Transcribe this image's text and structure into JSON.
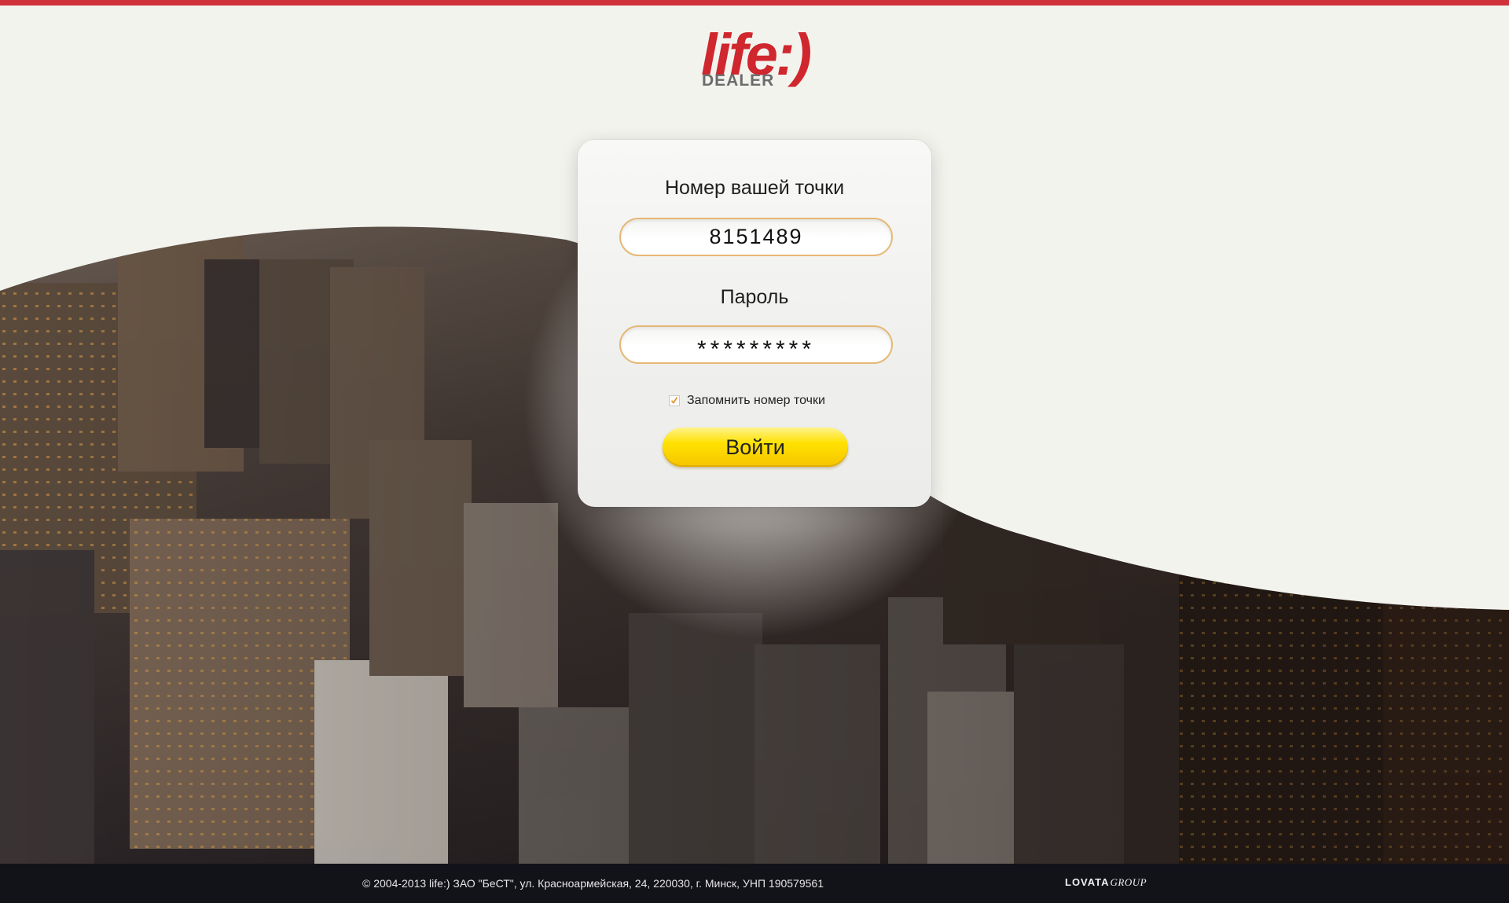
{
  "brand": {
    "logo_text": "life:)",
    "logo_sub": "DEALER",
    "accent_color": "#d0262e",
    "top_bar_color": "#d0303a"
  },
  "login_form": {
    "point_label": "Номер вашей точки",
    "point_value": "8151489",
    "password_label": "Пароль",
    "password_mask": "*********",
    "remember_label": "Запомнить номер точки",
    "remember_checked": true,
    "submit_label": "Войти",
    "input_border_color": "#e6b875",
    "button_color": "#ffe100"
  },
  "background": {
    "image": "city-skyline-aerial"
  },
  "footer": {
    "copyright": "© 2004-2013 life:) ЗАО \"БеСТ\", ул. Красноармейская, 24, 220030, г. Минск, УНП 190579561",
    "partner_a": "LOVATA",
    "partner_b": "GROUP"
  }
}
